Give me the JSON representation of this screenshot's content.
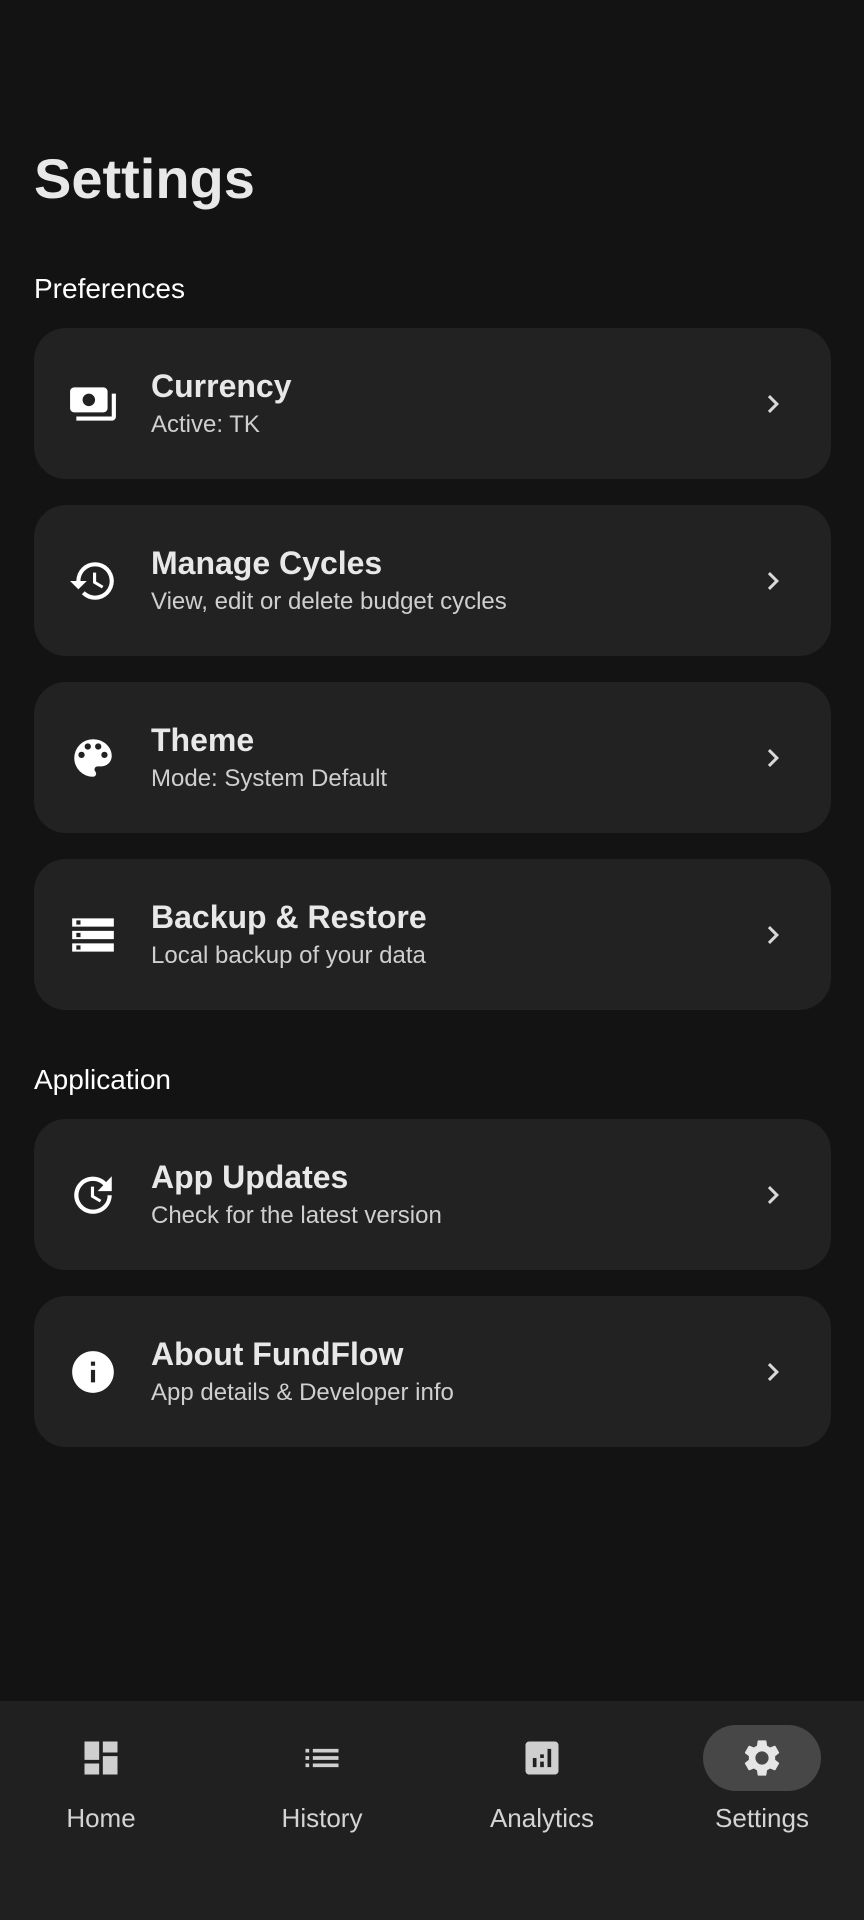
{
  "page": {
    "title": "Settings"
  },
  "sections": {
    "preferences": "Preferences",
    "application": "Application"
  },
  "cards": {
    "currency": {
      "title": "Currency",
      "subtitle": "Active: TK",
      "icon": "payments-icon"
    },
    "manage_cycles": {
      "title": "Manage Cycles",
      "subtitle": "View, edit or delete budget cycles",
      "icon": "history-icon"
    },
    "theme": {
      "title": "Theme",
      "subtitle": "Mode: System Default",
      "icon": "palette-icon"
    },
    "backup_restore": {
      "title": "Backup & Restore",
      "subtitle": "Local backup of your data",
      "icon": "storage-icon"
    },
    "app_updates": {
      "title": "App Updates",
      "subtitle": "Check for the latest version",
      "icon": "update-icon"
    },
    "about": {
      "title": "About FundFlow",
      "subtitle": "App details & Developer info",
      "icon": "info-icon"
    }
  },
  "bottom_nav": {
    "home": "Home",
    "history": "History",
    "analytics": "Analytics",
    "settings": "Settings",
    "active": "settings"
  },
  "colors": {
    "background": "#131313",
    "card": "#222222",
    "nav_background": "#202020",
    "nav_active_pill": "#474747",
    "text_primary": "#e8e8e8",
    "text_secondary": "#cfcfcf"
  }
}
